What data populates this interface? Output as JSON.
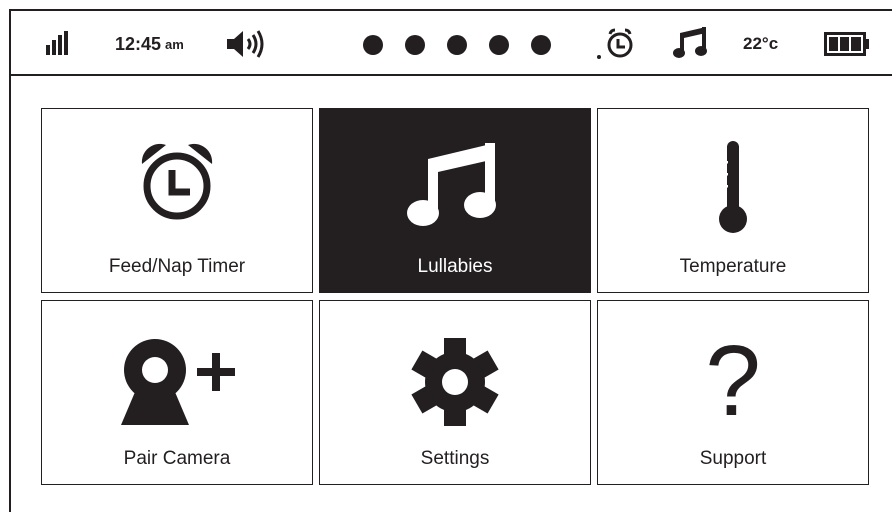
{
  "status_bar": {
    "signal_icon": "signal-bars-icon",
    "time": "12:45",
    "ampm": "am",
    "volume_icon": "speaker-volume-icon",
    "page_dots": 5,
    "alarm_icon": "alarm-clock-icon",
    "music_icon": "music-note-icon",
    "temperature": "22°c",
    "battery_icon": "battery-icon"
  },
  "menu": {
    "tiles": [
      {
        "label": "Feed/Nap Timer",
        "icon": "alarm-clock-icon",
        "selected": false
      },
      {
        "label": "Lullabies",
        "icon": "music-note-icon",
        "selected": true
      },
      {
        "label": "Temperature",
        "icon": "thermometer-icon",
        "selected": false
      },
      {
        "label": "Pair Camera",
        "icon": "add-camera-icon",
        "selected": false
      },
      {
        "label": "Settings",
        "icon": "gear-icon",
        "selected": false
      },
      {
        "label": "Support",
        "icon": "question-mark-icon",
        "selected": false
      }
    ],
    "support_glyph": "?"
  },
  "colors": {
    "ink": "#231f20",
    "background": "#ffffff",
    "selected_label": "#ffffff"
  }
}
